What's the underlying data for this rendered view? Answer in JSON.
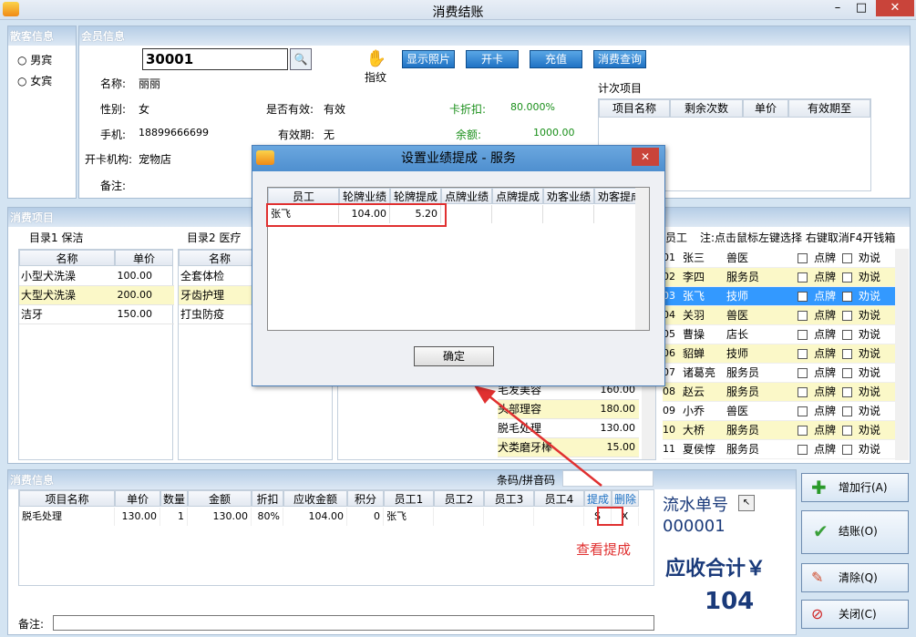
{
  "window": {
    "title": "消费结账",
    "min": "–",
    "max": "□",
    "close": "✕"
  },
  "guest": {
    "header": "散客信息",
    "male": "男宾",
    "female": "女宾"
  },
  "member": {
    "header": "会员信息",
    "card_label": "卡号：",
    "card_value": "30001",
    "fingerprint": "指纹",
    "buttons": {
      "photo": "显示照片",
      "open": "开卡",
      "recharge": "充值",
      "query": "消费查询"
    },
    "name_label": "名称:",
    "name": "丽丽",
    "gender_label": "性别:",
    "gender": "女",
    "valid_label": "是否有效:",
    "valid": "有效",
    "discount_label": "卡折扣:",
    "discount": "80.000%",
    "phone_label": "手机:",
    "phone": "18899666699",
    "expiry_label": "有效期:",
    "expiry": "无",
    "balance_label": "余额:",
    "balance": "1000.00",
    "store_label": "开卡机构:",
    "store": "宠物店",
    "note_label": "备注:",
    "count_items_label": "计次项目",
    "count_cols": [
      "项目名称",
      "剩余次数",
      "单价",
      "有效期至"
    ]
  },
  "items": {
    "header": "消费项目",
    "cat1_label": "目录1 保洁",
    "cat2_label": "目录2 医疗",
    "col_name": "名称",
    "col_price": "单价",
    "cat1_rows": [
      {
        "name": "小型犬洗澡",
        "price": "100.00"
      },
      {
        "name": "大型犬洗澡",
        "price": "200.00"
      },
      {
        "name": "洁牙",
        "price": "150.00"
      }
    ],
    "cat2_rows": [
      {
        "name": "全套体检"
      },
      {
        "name": "牙齿护理"
      },
      {
        "name": "打虫防疫"
      }
    ],
    "cat3_rows": [
      {
        "name": "毛发美容",
        "price": "160.00"
      },
      {
        "name": "头部理容",
        "price": "180.00"
      },
      {
        "name": "脱毛处理",
        "price": "130.00"
      },
      {
        "name": "犬类磨牙棒",
        "price": "15.00"
      }
    ]
  },
  "staff": {
    "header_label": "员工",
    "hint": "注:点击鼠标左键选择 右键取消F4开钱箱",
    "opt1": "点牌",
    "opt2": "劝说",
    "rows": [
      {
        "id": "01",
        "name": "张三",
        "role": "兽医"
      },
      {
        "id": "02",
        "name": "李四",
        "role": "服务员"
      },
      {
        "id": "03",
        "name": "张飞",
        "role": "技师"
      },
      {
        "id": "04",
        "name": "关羽",
        "role": "兽医"
      },
      {
        "id": "05",
        "name": "曹操",
        "role": "店长"
      },
      {
        "id": "06",
        "name": "貂蝉",
        "role": "技师"
      },
      {
        "id": "07",
        "name": "诸葛亮",
        "role": "服务员"
      },
      {
        "id": "08",
        "name": "赵云",
        "role": "服务员"
      },
      {
        "id": "09",
        "name": "小乔",
        "role": "兽医"
      },
      {
        "id": "10",
        "name": "大桥",
        "role": "服务员"
      },
      {
        "id": "11",
        "name": "夏侯惇",
        "role": "服务员"
      }
    ]
  },
  "consume": {
    "header": "消费信息",
    "barcode_label": "条码/拼音码",
    "cols": [
      "项目名称",
      "单价",
      "数量",
      "金额",
      "折扣",
      "应收金额",
      "积分",
      "员工1",
      "员工2",
      "员工3",
      "员工4",
      "提成",
      "删除"
    ],
    "row": {
      "name": "脱毛处理",
      "price": "130.00",
      "qty": "1",
      "amount": "130.00",
      "discount": "80%",
      "due": "104.00",
      "points": "0",
      "staff1": "张飞",
      "commission": "S",
      "delete": "X"
    },
    "note_label": "备注:",
    "annotation": "查看提成"
  },
  "summary": {
    "serial_label": "流水单号",
    "serial": "000001",
    "total_label": "应收合计￥",
    "total": "104"
  },
  "side_buttons": {
    "add": "增加行(A)",
    "checkout": "结账(O)",
    "clear": "清除(Q)",
    "close": "关闭(C)"
  },
  "dialog": {
    "title": "设置业绩提成 - 服务",
    "cols": [
      "员工",
      "轮牌业绩",
      "轮牌提成",
      "点牌业绩",
      "点牌提成",
      "劝客业绩",
      "劝客提成"
    ],
    "row": {
      "staff": "张飞",
      "perf": "104.00",
      "comm": "5.20"
    },
    "ok": "确定"
  },
  "colors": {
    "accent_blue": "#1f72c4",
    "highlight": "#3399ff",
    "annotation_red": "#e03030",
    "total_text": "#1a3a7a"
  }
}
